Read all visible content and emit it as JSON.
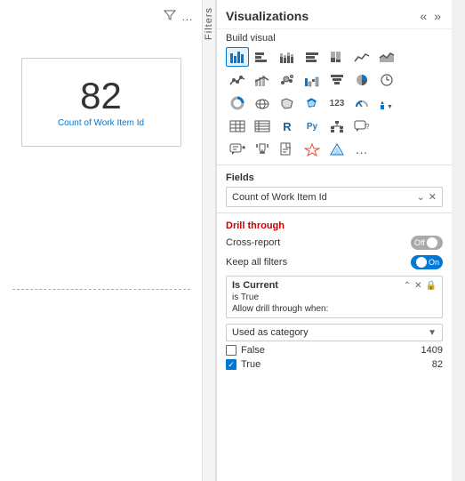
{
  "left": {
    "card_number": "82",
    "card_label": "Count of Work Item Id",
    "filters_label": "Filters"
  },
  "viz": {
    "title": "Visualizations",
    "build_visual": "Build visual",
    "fields_label": "Fields",
    "field_chip": "Count of Work Item Id",
    "drill_label": "Drill through",
    "cross_report": "Cross-report",
    "cross_report_state": "Off",
    "keep_filters": "Keep all filters",
    "keep_filters_state": "On",
    "filter_title": "Is Current",
    "filter_sub": "is True",
    "filter_drill_label": "Allow drill through when:",
    "dropdown_value": "Used as category",
    "rows": [
      {
        "label": "False",
        "count": "1409",
        "checked": false
      },
      {
        "label": "True",
        "count": "82",
        "checked": true
      }
    ]
  }
}
